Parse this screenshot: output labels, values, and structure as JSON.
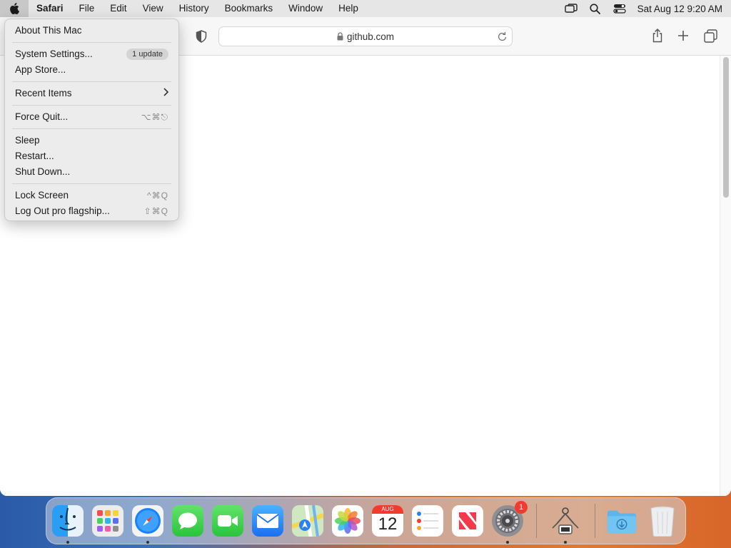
{
  "menubar": {
    "app_name": "Safari",
    "items": [
      "File",
      "Edit",
      "View",
      "History",
      "Bookmarks",
      "Window",
      "Help"
    ],
    "clock": "Sat Aug 12  9:20 AM"
  },
  "browser": {
    "url": "github.com"
  },
  "apple_menu": {
    "about": "About This Mac",
    "system_settings": "System Settings...",
    "system_settings_badge": "1 update",
    "app_store": "App Store...",
    "recent_items": "Recent Items",
    "force_quit": "Force Quit...",
    "force_quit_shortcut": "⌥⌘⎋",
    "sleep": "Sleep",
    "restart": "Restart...",
    "shut_down": "Shut Down...",
    "lock_screen": "Lock Screen",
    "lock_screen_shortcut": "^⌘Q",
    "log_out": "Log Out pro flagship...",
    "log_out_shortcut": "⇧⌘Q"
  },
  "dock": {
    "calendar_month": "AUG",
    "calendar_day": "12",
    "settings_badge": "1"
  },
  "colors": {
    "accent": "#1a82fb",
    "badge_red": "#f23b2f"
  }
}
